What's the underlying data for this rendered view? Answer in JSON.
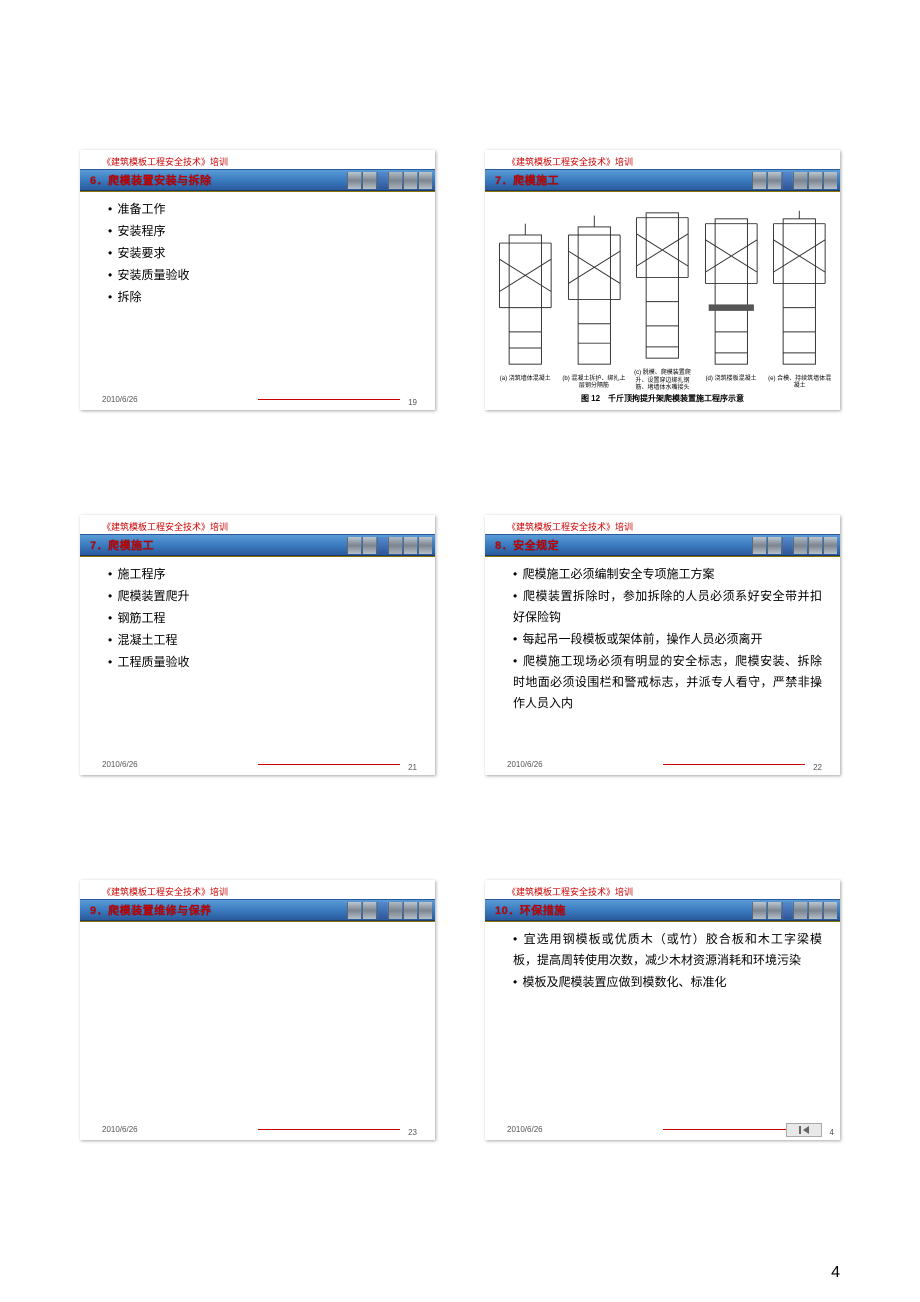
{
  "page_number": "4",
  "header_label": "《建筑模板工程安全技术》培训",
  "footer_date": "2010/6/26",
  "slides": [
    {
      "title": "6．爬模装置安装与拆除",
      "page": "19",
      "items": [
        "准备工作",
        "安装程序",
        "安装要求",
        "安装质量验收",
        "拆除"
      ]
    },
    {
      "title": "7．爬模施工",
      "page": "",
      "diagram": {
        "cols": [
          "(a) 浇筑墙体混凝土",
          "(b) 混凝土拆护、绑扎上层钢分隔筋",
          "(c) 脱模、爬模装置爬升、设置穿边绑扎钢筋、堵墙体水嘴接头",
          "(d) 浇筑楼板混凝土",
          "(e) 合模、持续筑墙体混凝土"
        ],
        "caption": "图 12　千斤顶拘提升架爬模装置施工程序示意"
      }
    },
    {
      "title": "7．爬模施工",
      "page": "21",
      "items": [
        "施工程序",
        "爬模装置爬升",
        "钢筋工程",
        "混凝土工程",
        "工程质量验收"
      ]
    },
    {
      "title": "8．安全规定",
      "page": "22",
      "items": [
        "爬模施工必须编制安全专项施工方案",
        "爬模装置拆除时，参加拆除的人员必须系好安全带并扣好保险钩",
        "每起吊一段模板或架体前，操作人员必须离开",
        "爬模施工现场必须有明显的安全标志，爬模安装、拆除时地面必须设围栏和警戒标志，并派专人看守，严禁非操作人员入内"
      ]
    },
    {
      "title": "9．爬模装置维修与保养",
      "page": "23",
      "items": []
    },
    {
      "title": "10．环保措施",
      "page": "4",
      "nav": true,
      "items": [
        "宜选用钢模板或优质木（或竹）胶合板和木工字梁模板，提高周转使用次数，减少木材资源消耗和环境污染",
        "模板及爬模装置应做到模数化、标准化"
      ]
    }
  ]
}
